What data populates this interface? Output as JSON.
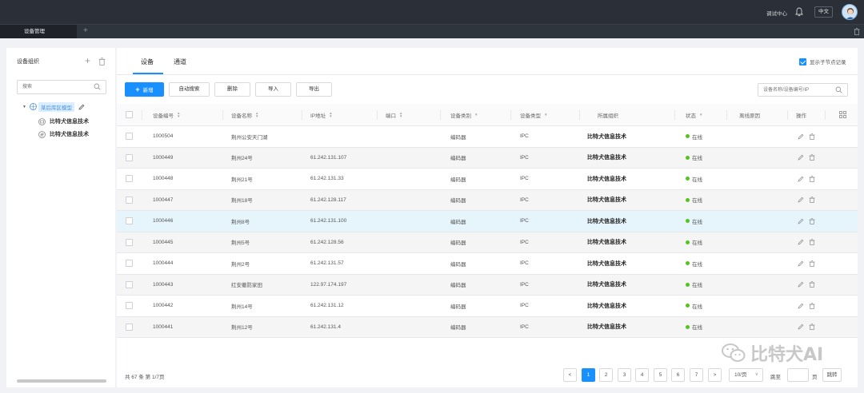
{
  "topbar": {
    "help_center": "调试中心",
    "language": "中文"
  },
  "tabbar": {
    "active_tab": "设备管理",
    "add_tab": "+"
  },
  "sidebar": {
    "title": "设备组织",
    "add": "+",
    "search_placeholder": "搜索",
    "tree": {
      "root_label": "某后库区模型",
      "children": [
        "比特犬信息技术",
        "比特犬信息技术"
      ]
    }
  },
  "main": {
    "tabs": [
      {
        "label": "设备",
        "active": true
      },
      {
        "label": "通道",
        "active": false
      }
    ],
    "show_subnode_records": "显示子节点记录",
    "toolbar": {
      "add_plus": "+",
      "add": "新增",
      "auto_search": "自动搜索",
      "delete": "删除",
      "import": "导入",
      "export": "导出"
    },
    "device_search_placeholder": "设备名称/设备编号/IP",
    "columns": [
      "设备编号",
      "设备名称",
      "IP地址",
      "端口",
      "设备类别",
      "设备类型",
      "所属组织",
      "状态",
      "离线原因",
      "操作"
    ],
    "rows": [
      {
        "id": "1000504",
        "name": "荆州公安天门湖",
        "ip": "",
        "port": "",
        "category": "编码器",
        "type": "IPC",
        "org": "比特犬信息技术",
        "status": "在线",
        "offline_reason": ""
      },
      {
        "id": "1000449",
        "name": "荆州24号",
        "ip": "61.242.131.107",
        "port": "",
        "category": "编码器",
        "type": "IPC",
        "org": "比特犬信息技术",
        "status": "在线",
        "offline_reason": ""
      },
      {
        "id": "1000448",
        "name": "荆州21号",
        "ip": "61.242.131.33",
        "port": "",
        "category": "编码器",
        "type": "IPC",
        "org": "比特犬信息技术",
        "status": "在线",
        "offline_reason": ""
      },
      {
        "id": "1000447",
        "name": "荆州18号",
        "ip": "61.242.128.117",
        "port": "",
        "category": "编码器",
        "type": "IPC",
        "org": "比特犬信息技术",
        "status": "在线",
        "offline_reason": ""
      },
      {
        "id": "1000446",
        "name": "荆州8号",
        "ip": "61.242.131.100",
        "port": "",
        "category": "编码器",
        "type": "IPC",
        "org": "比特犬信息技术",
        "status": "在线",
        "offline_reason": ""
      },
      {
        "id": "1000445",
        "name": "荆州5号",
        "ip": "61.242.128.56",
        "port": "",
        "category": "编码器",
        "type": "IPC",
        "org": "比特犬信息技术",
        "status": "在线",
        "offline_reason": ""
      },
      {
        "id": "1000444",
        "name": "荆州2号",
        "ip": "61.242.131.57",
        "port": "",
        "category": "编码器",
        "type": "IPC",
        "org": "比特犬信息技术",
        "status": "在线",
        "offline_reason": ""
      },
      {
        "id": "1000443",
        "name": "红安撤防家田",
        "ip": "122.97.174.197",
        "port": "",
        "category": "编码器",
        "type": "IPC",
        "org": "比特犬信息技术",
        "status": "在线",
        "offline_reason": ""
      },
      {
        "id": "1000442",
        "name": "荆州14号",
        "ip": "61.242.131.12",
        "port": "",
        "category": "编码器",
        "type": "IPC",
        "org": "比特犬信息技术",
        "status": "在线",
        "offline_reason": ""
      },
      {
        "id": "1000441",
        "name": "荆州12号",
        "ip": "61.242.131.4",
        "port": "",
        "category": "编码器",
        "type": "IPC",
        "org": "比特犬信息技术",
        "status": "在线",
        "offline_reason": ""
      }
    ],
    "pagination": {
      "total_text": "共 67 条 第 1/7页",
      "prev": "<",
      "pages": [
        "1",
        "2",
        "3",
        "4",
        "5",
        "6",
        "7"
      ],
      "current_page": "1",
      "next": ">",
      "page_size": "10/页",
      "jump_label": "跳至",
      "page_suffix": "页",
      "jump_button": "跳转"
    }
  },
  "watermark": "比特犬AI",
  "colors": {
    "topbar": "#2b3038",
    "accent": "#1890ff",
    "online": "#52c41a",
    "row_hover": "#e6f4fc"
  }
}
